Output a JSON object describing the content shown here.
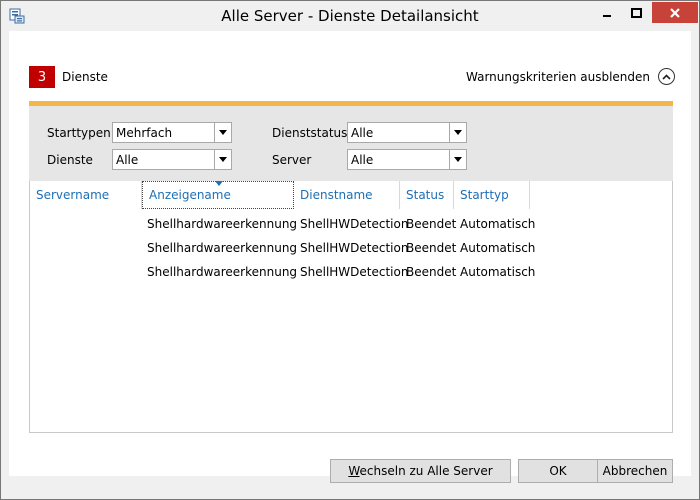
{
  "window": {
    "title": "Alle Server - Dienste Detailansicht"
  },
  "summary": {
    "count": "3",
    "label": "Dienste",
    "toggle_label": "Warnungskriterien ausblenden"
  },
  "filters": {
    "starttypen_label": "Starttypen",
    "starttypen_value": "Mehrfach",
    "dienste_label": "Dienste",
    "dienste_value": "Alle",
    "dienststatus_label": "Dienststatus",
    "dienststatus_value": "Alle",
    "server_label": "Server",
    "server_value": "Alle"
  },
  "table": {
    "columns": [
      "Servername",
      "Anzeigename",
      "Dienstname",
      "Status",
      "Starttyp"
    ],
    "rows": [
      [
        "",
        "Shellhardwareerkennung",
        "ShellHWDetection",
        "Beendet",
        "Automatisch"
      ],
      [
        "",
        "Shellhardwareerkennung",
        "ShellHWDetection",
        "Beendet",
        "Automatisch"
      ],
      [
        "",
        "Shellhardwareerkennung",
        "ShellHWDetection",
        "Beendet",
        "Automatisch"
      ]
    ]
  },
  "buttons": {
    "switch_mnemonic": "W",
    "switch_rest": "echseln zu Alle Server",
    "ok": "OK",
    "cancel": "Abbrechen"
  },
  "colors": {
    "badge": "#c00000",
    "accent_bar": "#f4b54a",
    "header_text": "#1f6fb4",
    "close_button": "#c7433a"
  }
}
